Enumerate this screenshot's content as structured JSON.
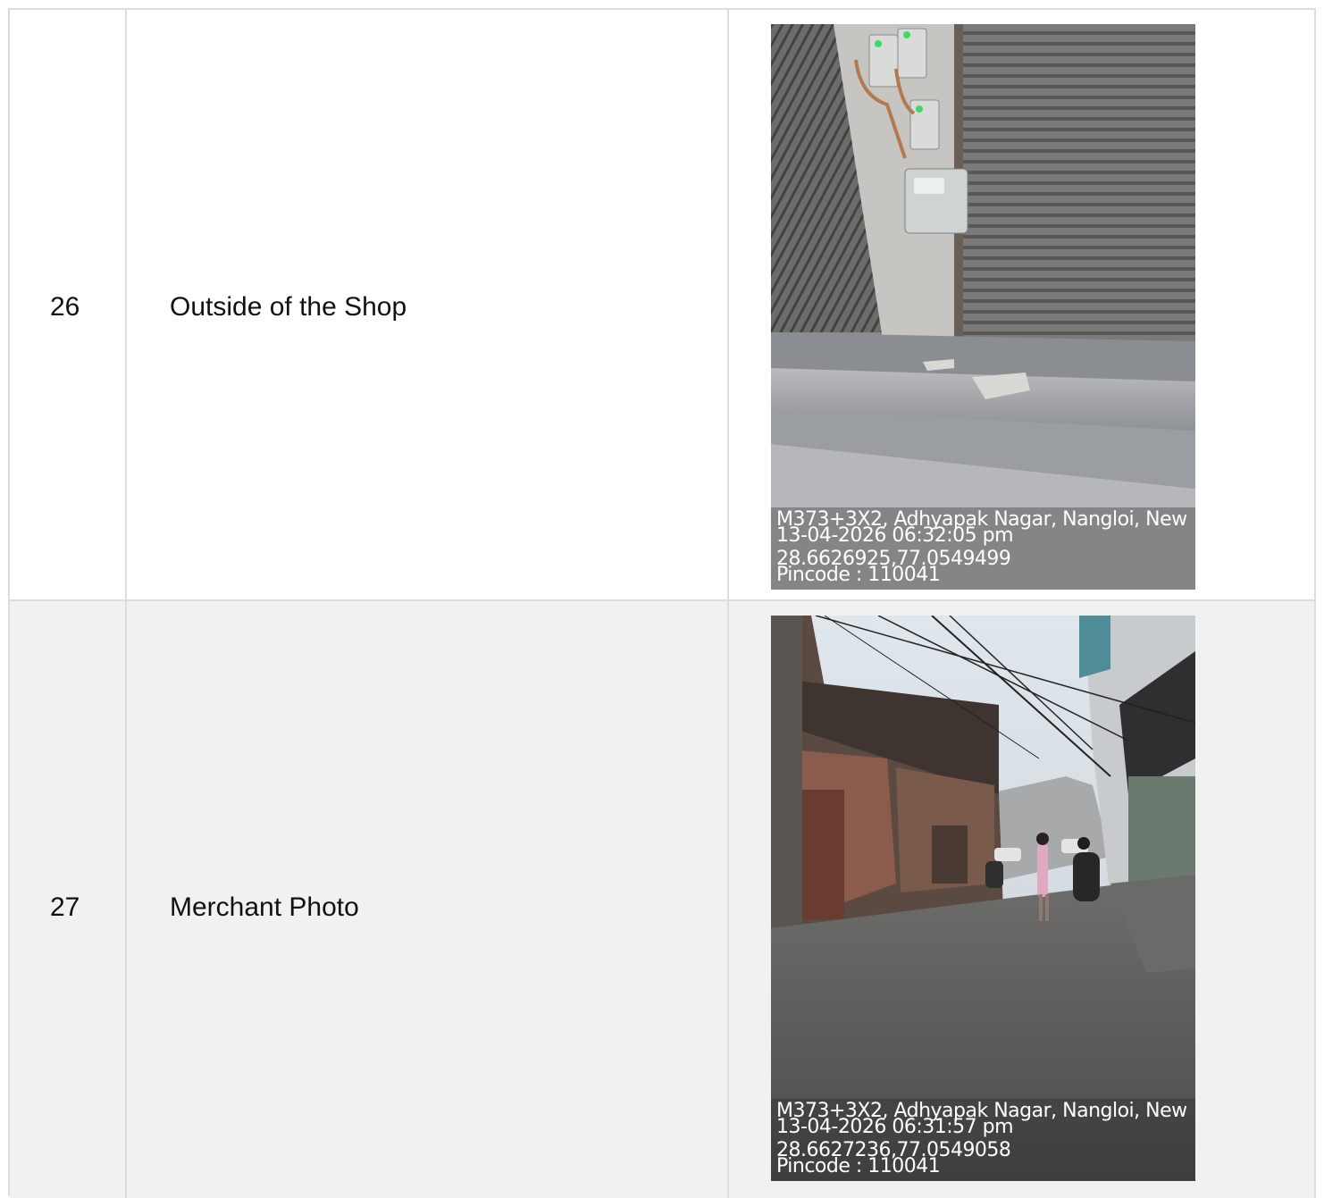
{
  "rows": [
    {
      "number": "26",
      "description": "Outside of the Shop",
      "photo": {
        "address": "M373+3X2, Adhyapak Nagar, Nangloi, New",
        "datetime": "13-04-2026 06:32:05 pm",
        "coordinates": "28.6626925,77.0549499",
        "pincode": "Pincode : 110041"
      }
    },
    {
      "number": "27",
      "description": "Merchant Photo",
      "photo": {
        "address": "M373+3X2, Adhyapak Nagar, Nangloi, New",
        "datetime": "13-04-2026 06:31:57 pm",
        "coordinates": "28.6627236,77.0549058",
        "pincode": "Pincode : 110041"
      }
    }
  ]
}
